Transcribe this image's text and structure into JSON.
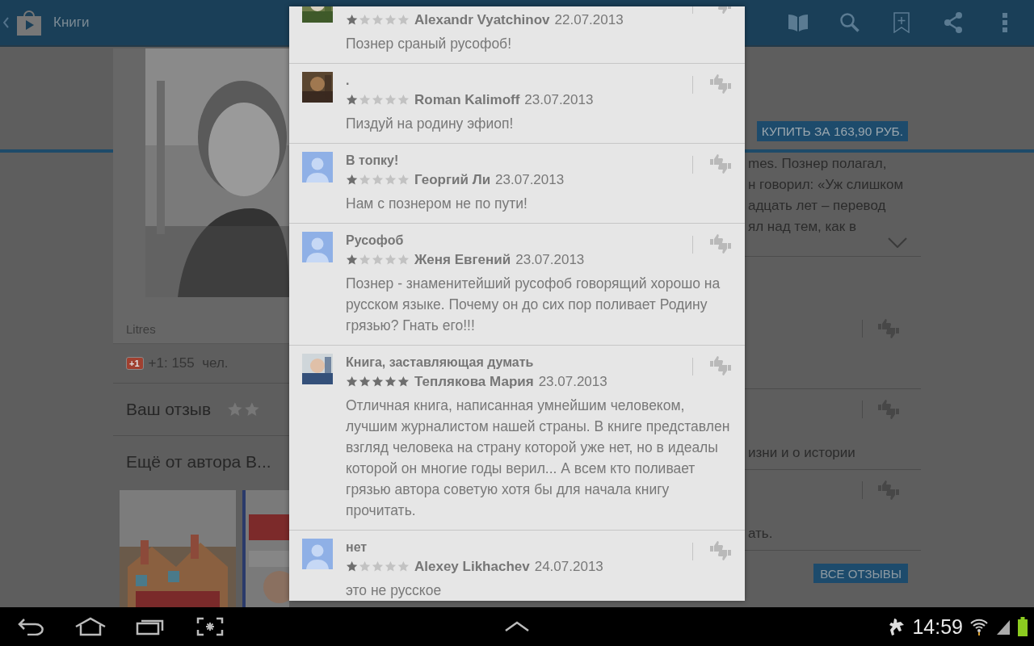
{
  "action_bar": {
    "title": "Книги"
  },
  "book_panel": {
    "publisher": "Litres",
    "plus_one_badge": "+1",
    "plus_one_count": "+1: 155  чел.",
    "your_review": {
      "label": "Ваш отзыв"
    },
    "more_by_author": "Ещё от автора В..."
  },
  "details": {
    "buy_button": "КУПИТЬ ЗА 163,90 РУБ.",
    "description_lines": [
      "mes. Познер полагал,",
      "н говорил: «Уж слишком",
      "адцать лет – перевод",
      "ял над тем, как в"
    ],
    "review_rows": [
      {},
      {
        "text": "изни и о истории"
      },
      {
        "text": "ать."
      }
    ],
    "all_reviews_button": "ВСЕ ОТЗЫВЫ"
  },
  "reviews": [
    {
      "stars": 1,
      "author": "Alexandr Vyatchinov",
      "date": "22.07.2013",
      "text": "Познер сраный русофоб!"
    },
    {
      "title": ".",
      "stars": 1,
      "author": "Roman Kalimoff",
      "date": "23.07.2013",
      "text": "Пиздуй на родину эфиоп!"
    },
    {
      "kind": "default",
      "title": "В топку!",
      "stars": 1,
      "author": "Георгий Ли",
      "date": "23.07.2013",
      "text": "Нам с познером не по пути!"
    },
    {
      "kind": "default",
      "title": "Русофоб",
      "stars": 1,
      "author": "Женя Евгений",
      "date": "23.07.2013",
      "text": "Познер - знаменитейший русофоб говорящий хорошо на русском языке. Почему он до сих пор поливает Родину грязью? Гнать его!!!"
    },
    {
      "title": "Книга, заставляющая думать",
      "stars": 5,
      "author": "Теплякова Мария",
      "date": "23.07.2013",
      "text": "Отличная книга, написанная умнейшим человеком, лучшим журналистом нашей страны. В книге представлен взгляд человека на страну которой уже нет, но в идеалы которой он многие годы верил... А всем кто поливает грязью автора советую хотя бы для начала книгу прочитать."
    },
    {
      "kind": "default",
      "title": "нет",
      "stars": 1,
      "author": "Alexey Likhachev",
      "date": "24.07.2013",
      "text": "это не русское"
    }
  ],
  "status_bar": {
    "time": "14:59"
  }
}
